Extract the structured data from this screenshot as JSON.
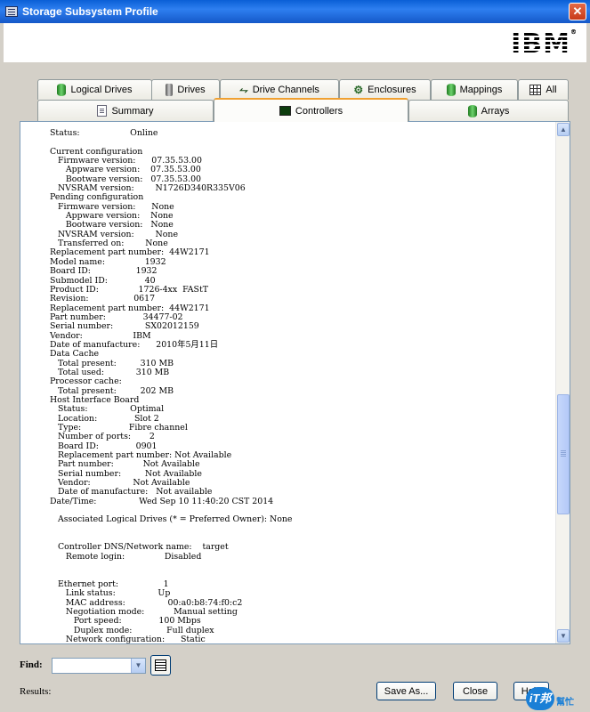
{
  "window": {
    "title": "Storage Subsystem Profile",
    "close_glyph": "✕"
  },
  "logo": {
    "text": "IBM",
    "mark": "®"
  },
  "tabs": {
    "row1": [
      {
        "label": "Logical Drives",
        "icon": "logical-drive-icon"
      },
      {
        "label": "Drives",
        "icon": "drive-icon"
      },
      {
        "label": "Drive Channels",
        "icon": "drive-channel-icon"
      },
      {
        "label": "Enclosures",
        "icon": "enclosure-icon"
      },
      {
        "label": "Mappings",
        "icon": "mapping-icon"
      },
      {
        "label": "All",
        "icon": "grid-icon"
      }
    ],
    "row2": [
      {
        "label": "Summary",
        "icon": "summary-doc-icon"
      },
      {
        "label": "Controllers",
        "icon": "controller-icon",
        "active": true
      },
      {
        "label": "Arrays",
        "icon": "arrays-icon"
      }
    ]
  },
  "profile_text": "Status:                   Online\n\nCurrent configuration\n   Firmware version:      07.35.53.00\n      Appware version:    07.35.53.00\n      Bootware version:   07.35.53.00\n   NVSRAM version:        N1726D340R335V06\nPending configuration\n   Firmware version:      None\n      Appware version:    None\n      Bootware version:   None\n   NVSRAM version:        None\n   Transferred on:        None\nReplacement part number:  44W2171\nModel name:               1932\nBoard ID:                 1932\nSubmodel ID:              40\nProduct ID:               1726-4xx  FAStT\nRevision:                 0617\nReplacement part number:  44W2171\nPart number:              34477-02\nSerial number:            SX02012159\nVendor:                   IBM\nDate of manufacture:      2010年5月11日\nData Cache\n   Total present:         310 MB\n   Total used:            310 MB\nProcessor cache:\n   Total present:         202 MB\nHost Interface Board\n   Status:                Optimal\n   Location:              Slot 2\n   Type:                  Fibre channel\n   Number of ports:       2\n   Board ID:              0901\n   Replacement part number: Not Available\n   Part number:           Not Available\n   Serial number:         Not Available\n   Vendor:                Not Available\n   Date of manufacture:   Not available\nDate/Time:                Wed Sep 10 11:40:20 CST 2014\n\n   Associated Logical Drives (* = Preferred Owner): None\n\n\n   Controller DNS/Network name:    target\n      Remote login:               Disabled\n\n\n   Ethernet port:                 1\n      Link status:                Up\n      MAC address:                00:a0:b8:74:f0:c2\n      Negotiation mode:           Manual setting\n         Port speed:              100 Mbps\n         Duplex mode:             Full duplex\n      Network configuration:      Static",
  "find": {
    "label": "Find:",
    "value": "",
    "placeholder": ""
  },
  "footer": {
    "results_label": "Results:",
    "save_as": "Save As...",
    "close": "Close",
    "help": "Help"
  },
  "watermark": {
    "badge": "iT邦",
    "text": "幫忙"
  }
}
